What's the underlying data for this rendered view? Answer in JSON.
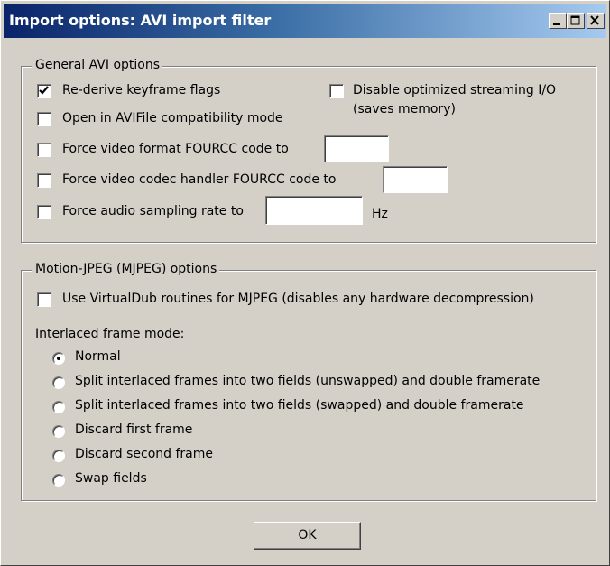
{
  "window": {
    "title": "Import options: AVI import filter",
    "controls": [
      "minimize-icon",
      "maximize-icon",
      "close-icon"
    ]
  },
  "general": {
    "legend": "General AVI options",
    "rederive": {
      "label": "Re-derive keyframe flags",
      "checked": true
    },
    "disable_streaming": {
      "label_line1": "Disable optimized streaming I/O",
      "label_line2": "(saves memory)",
      "checked": false
    },
    "avifile_compat": {
      "label": "Open in AVIFile compatibility mode",
      "checked": false
    },
    "force_video_format": {
      "label": "Force video format FOURCC code to",
      "checked": false,
      "value": ""
    },
    "force_codec_handler": {
      "label": "Force video codec handler FOURCC code to",
      "checked": false,
      "value": ""
    },
    "force_audio_rate": {
      "label": "Force audio sampling rate to",
      "checked": false,
      "value": "",
      "unit": "Hz"
    }
  },
  "mjpeg": {
    "legend": "Motion-JPEG (MJPEG) options",
    "use_vd_routines": {
      "label": "Use VirtualDub routines for MJPEG (disables any hardware decompression)",
      "checked": false
    },
    "interlace_label": "Interlaced frame mode:",
    "modes": [
      {
        "label": "Normal",
        "selected": true
      },
      {
        "label": "Split interlaced frames into two fields (unswapped) and double framerate",
        "selected": false
      },
      {
        "label": "Split interlaced frames into two fields (swapped) and double framerate",
        "selected": false
      },
      {
        "label": "Discard first frame",
        "selected": false
      },
      {
        "label": "Discard second frame",
        "selected": false
      },
      {
        "label": "Swap fields",
        "selected": false
      }
    ]
  },
  "ok_label": "OK"
}
